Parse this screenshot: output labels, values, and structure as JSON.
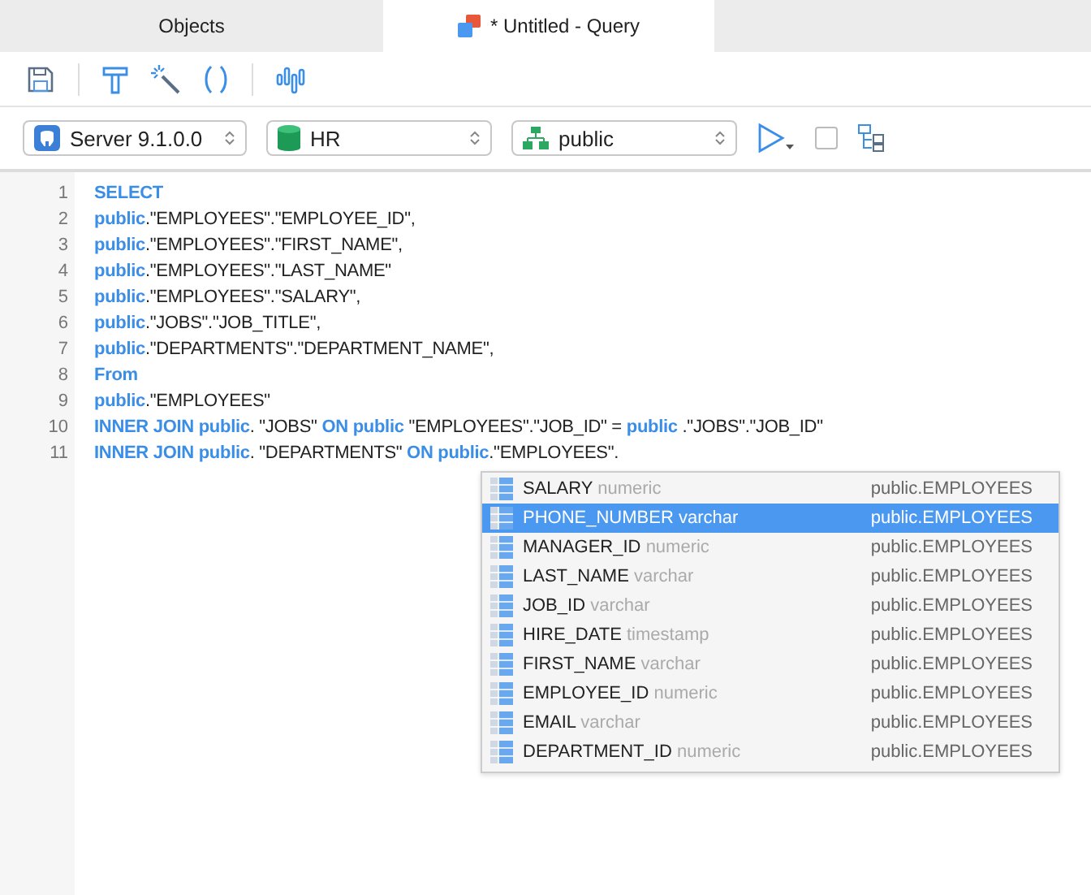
{
  "tabs": [
    {
      "label": "Objects",
      "selected": false,
      "kind": "plain"
    },
    {
      "label": "* Untitled - Query",
      "selected": true,
      "kind": "query"
    }
  ],
  "toolbar": {
    "run_checkbox": {
      "checked": false
    }
  },
  "selectors": [
    {
      "kind": "server",
      "value": "Server 9.1.0.0"
    },
    {
      "kind": "database",
      "value": "HR"
    },
    {
      "kind": "schema",
      "value": "public"
    }
  ],
  "editor": {
    "lines": [
      {
        "number": "1",
        "tokens": [
          {
            "kind": "keyword",
            "text": "SELECT"
          }
        ]
      },
      {
        "number": "2",
        "tokens": [
          {
            "kind": "keyword",
            "text": "public"
          },
          {
            "kind": "text",
            "text": ".\"EMPLOYEES\".\"EMPLOYEE_ID\","
          }
        ]
      },
      {
        "number": "3",
        "tokens": [
          {
            "kind": "keyword",
            "text": "public"
          },
          {
            "kind": "text",
            "text": ".\"EMPLOYEES\".\"FIRST_NAME\","
          }
        ]
      },
      {
        "number": "4",
        "tokens": [
          {
            "kind": "keyword",
            "text": "public"
          },
          {
            "kind": "text",
            "text": ".\"EMPLOYEES\".\"LAST_NAME\""
          }
        ]
      },
      {
        "number": "5",
        "tokens": [
          {
            "kind": "keyword",
            "text": "public"
          },
          {
            "kind": "text",
            "text": ".\"EMPLOYEES\".\"SALARY\","
          }
        ]
      },
      {
        "number": "6",
        "tokens": [
          {
            "kind": "keyword",
            "text": "public"
          },
          {
            "kind": "text",
            "text": ".\"JOBS\".\"JOB_TITLE\","
          }
        ]
      },
      {
        "number": "7",
        "tokens": [
          {
            "kind": "keyword",
            "text": "public"
          },
          {
            "kind": "text",
            "text": ".\"DEPARTMENTS\".\"DEPARTMENT_NAME\","
          }
        ]
      },
      {
        "number": "8",
        "tokens": [
          {
            "kind": "keyword",
            "text": "From"
          }
        ]
      },
      {
        "number": "9",
        "tokens": [
          {
            "kind": "keyword",
            "text": "public"
          },
          {
            "kind": "text",
            "text": ".\"EMPLOYEES\""
          }
        ]
      },
      {
        "number": "10",
        "tokens": [
          {
            "kind": "keyword",
            "text": "INNER JOIN public"
          },
          {
            "kind": "text",
            "text": ". \"JOBS\" "
          },
          {
            "kind": "keyword",
            "text": "ON public"
          },
          {
            "kind": "text",
            "text": " \"EMPLOYEES\".\"JOB_ID\" = "
          },
          {
            "kind": "keyword",
            "text": "public"
          },
          {
            "kind": "text",
            "text": " .\"JOBS\".\"JOB_ID\""
          }
        ]
      },
      {
        "number": "11",
        "tokens": [
          {
            "kind": "keyword",
            "text": "INNER JOIN public"
          },
          {
            "kind": "text",
            "text": ". \"DEPARTMENTS\" "
          },
          {
            "kind": "keyword",
            "text": "ON public"
          },
          {
            "kind": "text",
            "text": ".\"EMPLOYEES\"."
          }
        ]
      }
    ]
  },
  "autocomplete": [
    {
      "name": "SALARY",
      "type": "numeric",
      "source": "public.EMPLOYEES",
      "selected": false
    },
    {
      "name": "PHONE_NUMBER",
      "type": "varchar",
      "source": "public.EMPLOYEES",
      "selected": true
    },
    {
      "name": "MANAGER_ID",
      "type": "numeric",
      "source": "public.EMPLOYEES",
      "selected": false
    },
    {
      "name": "LAST_NAME",
      "type": "varchar",
      "source": "public.EMPLOYEES",
      "selected": false
    },
    {
      "name": "JOB_ID",
      "type": "varchar",
      "source": "public.EMPLOYEES",
      "selected": false
    },
    {
      "name": "HIRE_DATE",
      "type": "timestamp",
      "source": "public.EMPLOYEES",
      "selected": false
    },
    {
      "name": "FIRST_NAME",
      "type": "varchar",
      "source": "public.EMPLOYEES",
      "selected": false
    },
    {
      "name": "EMPLOYEE_ID",
      "type": "numeric",
      "source": "public.EMPLOYEES",
      "selected": false
    },
    {
      "name": "EMAIL",
      "type": "varchar",
      "source": "public.EMPLOYEES",
      "selected": false
    },
    {
      "name": "DEPARTMENT_ID",
      "type": "numeric",
      "source": "public.EMPLOYEES",
      "selected": false
    }
  ]
}
